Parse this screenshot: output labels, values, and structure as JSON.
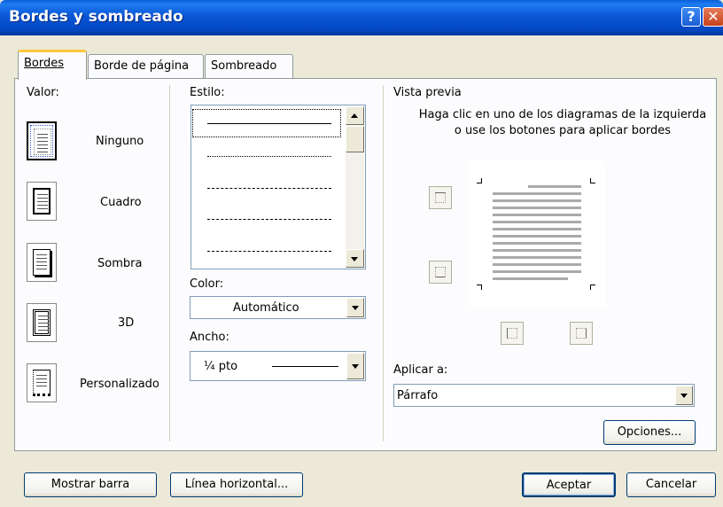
{
  "window": {
    "title": "Bordes y sombreado"
  },
  "titlebar_buttons": {
    "help": "?",
    "close": "✕"
  },
  "tabs": [
    {
      "label": "Bordes",
      "active": true
    },
    {
      "label": "Borde de página",
      "active": false
    },
    {
      "label": "Sombreado",
      "active": false
    }
  ],
  "value_section": {
    "label": "Valor:",
    "items": [
      {
        "label": "Ninguno",
        "icon": "none-border-icon",
        "selected": true
      },
      {
        "label": "Cuadro",
        "icon": "box-border-icon"
      },
      {
        "label": "Sombra",
        "icon": "shadow-border-icon"
      },
      {
        "label": "3D",
        "icon": "3d-border-icon"
      },
      {
        "label": "Personalizado",
        "icon": "custom-border-icon"
      }
    ]
  },
  "style_section": {
    "label": "Estilo:",
    "styles": [
      "solid",
      "dotted",
      "dashed-small",
      "dashed",
      "dash-dot"
    ]
  },
  "color_section": {
    "label": "Color:",
    "value": "Automático"
  },
  "width_section": {
    "label": "Ancho:",
    "value": "¼ pto"
  },
  "preview_section": {
    "label": "Vista previa",
    "hint": "Haga clic en uno de los diagramas de la izquierda o use los botones para aplicar bordes"
  },
  "apply_section": {
    "label": "Aplicar a:",
    "value": "Párrafo"
  },
  "buttons": {
    "options": "Opciones...",
    "show_toolbar": "Mostrar barra",
    "horizontal_line": "Línea horizontal...",
    "ok": "Aceptar",
    "cancel": "Cancelar"
  },
  "colors": {
    "titlebar": "#0856d6",
    "dialog_bg": "#ece9d8",
    "panel_bg": "#fcfcfe",
    "tab_highlight": "#ffc83c"
  }
}
